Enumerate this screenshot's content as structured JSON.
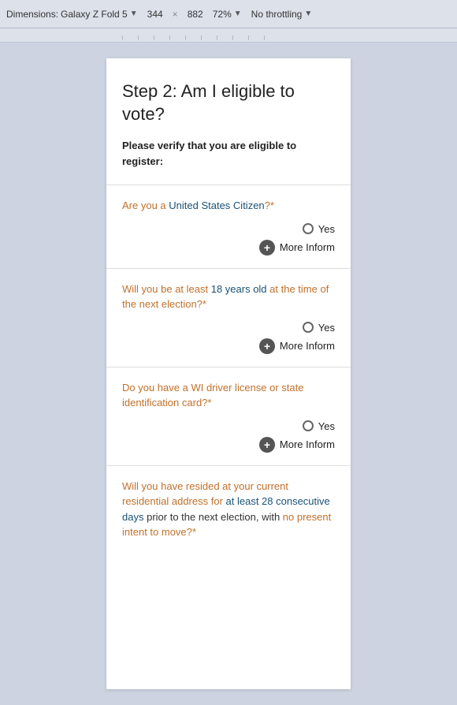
{
  "toolbar": {
    "dimensions_label": "Dimensions:",
    "device_name": "Galaxy Z Fold 5",
    "width": "344",
    "cross": "×",
    "height": "882",
    "zoom": "72%",
    "throttling": "No throttling"
  },
  "card": {
    "step_title": "Step 2: Am I eligible to vote?",
    "subtitle": "Please verify that you are eligible to register:",
    "questions": [
      {
        "id": "q1",
        "text_parts": [
          {
            "text": "Are you a ",
            "color": "orange"
          },
          {
            "text": "United States Citizen",
            "color": "blue"
          },
          {
            "text": "?*",
            "color": "orange"
          }
        ],
        "full_text": "Are you a United States Citizen?*",
        "yes_label": "Yes",
        "more_info_label": "More Inform"
      },
      {
        "id": "q2",
        "text_parts": [
          {
            "text": "Will you be at least ",
            "color": "orange"
          },
          {
            "text": "18 years old",
            "color": "blue"
          },
          {
            "text": " at the time of the next election?*",
            "color": "orange"
          }
        ],
        "full_text": "Will you be at least 18 years old at the time of the next election?*",
        "yes_label": "Yes",
        "more_info_label": "More Inform"
      },
      {
        "id": "q3",
        "text_parts": [
          {
            "text": "Do you have a WI driver license or state identification card?*",
            "color": "orange"
          }
        ],
        "full_text": "Do you have a WI driver license or state identification card?*",
        "yes_label": "Yes",
        "more_info_label": "More Inform"
      },
      {
        "id": "q4",
        "text_parts": [
          {
            "text": "Will you have resided at your current residential address for at least 28 consecutive days prior to the next election, with no present intent to move?*",
            "color": "orange"
          }
        ],
        "full_text": "Will you have resided at your current residential address for at least 28 consecutive days prior to the next election, with no present intent to move?*"
      }
    ]
  }
}
